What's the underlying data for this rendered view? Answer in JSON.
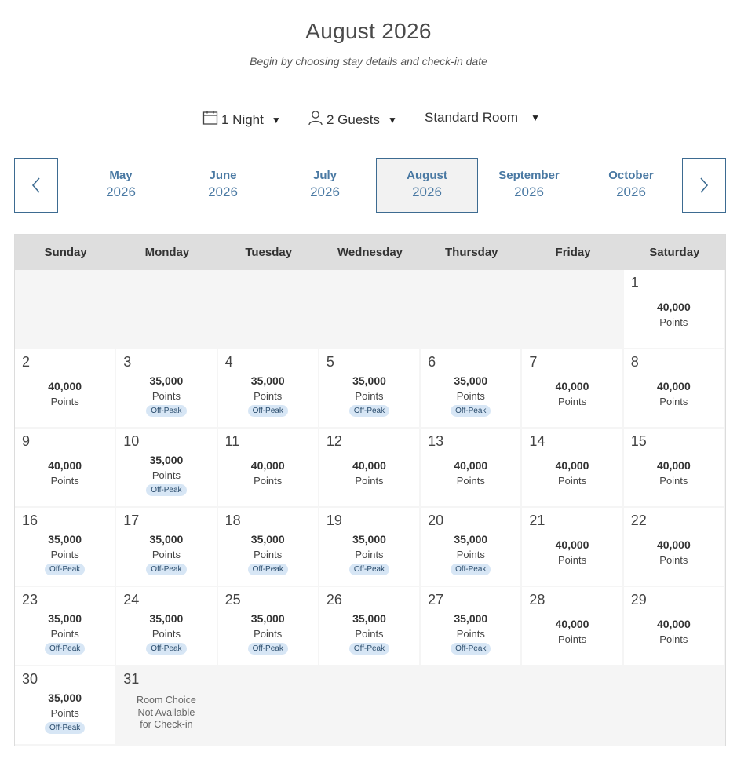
{
  "title": "August 2026",
  "subtitle": "Begin by choosing stay details and check-in date",
  "filters": {
    "nights": "1 Night",
    "guests": "2 Guests",
    "room": "Standard Room"
  },
  "months": [
    {
      "name": "May",
      "year": "2026",
      "active": false
    },
    {
      "name": "June",
      "year": "2026",
      "active": false
    },
    {
      "name": "July",
      "year": "2026",
      "active": false
    },
    {
      "name": "August",
      "year": "2026",
      "active": true
    },
    {
      "name": "September",
      "year": "2026",
      "active": false
    },
    {
      "name": "October",
      "year": "2026",
      "active": false
    }
  ],
  "weekdays": [
    "Sunday",
    "Monday",
    "Tuesday",
    "Wednesday",
    "Thursday",
    "Friday",
    "Saturday"
  ],
  "leading_blank_days": 6,
  "labels": {
    "points": "Points",
    "off_peak": "Off-Peak"
  },
  "days": [
    {
      "day": "1",
      "points": "40,000",
      "off_peak": false
    },
    {
      "day": "2",
      "points": "40,000",
      "off_peak": false
    },
    {
      "day": "3",
      "points": "35,000",
      "off_peak": true
    },
    {
      "day": "4",
      "points": "35,000",
      "off_peak": true
    },
    {
      "day": "5",
      "points": "35,000",
      "off_peak": true
    },
    {
      "day": "6",
      "points": "35,000",
      "off_peak": true
    },
    {
      "day": "7",
      "points": "40,000",
      "off_peak": false
    },
    {
      "day": "8",
      "points": "40,000",
      "off_peak": false
    },
    {
      "day": "9",
      "points": "40,000",
      "off_peak": false
    },
    {
      "day": "10",
      "points": "35,000",
      "off_peak": true
    },
    {
      "day": "11",
      "points": "40,000",
      "off_peak": false
    },
    {
      "day": "12",
      "points": "40,000",
      "off_peak": false
    },
    {
      "day": "13",
      "points": "40,000",
      "off_peak": false
    },
    {
      "day": "14",
      "points": "40,000",
      "off_peak": false
    },
    {
      "day": "15",
      "points": "40,000",
      "off_peak": false
    },
    {
      "day": "16",
      "points": "35,000",
      "off_peak": true
    },
    {
      "day": "17",
      "points": "35,000",
      "off_peak": true
    },
    {
      "day": "18",
      "points": "35,000",
      "off_peak": true
    },
    {
      "day": "19",
      "points": "35,000",
      "off_peak": true
    },
    {
      "day": "20",
      "points": "35,000",
      "off_peak": true
    },
    {
      "day": "21",
      "points": "40,000",
      "off_peak": false
    },
    {
      "day": "22",
      "points": "40,000",
      "off_peak": false
    },
    {
      "day": "23",
      "points": "35,000",
      "off_peak": true
    },
    {
      "day": "24",
      "points": "35,000",
      "off_peak": true
    },
    {
      "day": "25",
      "points": "35,000",
      "off_peak": true
    },
    {
      "day": "26",
      "points": "35,000",
      "off_peak": true
    },
    {
      "day": "27",
      "points": "35,000",
      "off_peak": true
    },
    {
      "day": "28",
      "points": "40,000",
      "off_peak": false
    },
    {
      "day": "29",
      "points": "40,000",
      "off_peak": false
    },
    {
      "day": "30",
      "points": "35,000",
      "off_peak": true
    },
    {
      "day": "31",
      "unavailable": true,
      "note_lines": [
        "Room Choice",
        "Not Available",
        "for Check-in"
      ]
    }
  ],
  "colors": {
    "accent": "#3d6b91",
    "month_text": "#4a79a3",
    "badge_bg": "#d7e6f5",
    "header_bg": "#dedede"
  }
}
